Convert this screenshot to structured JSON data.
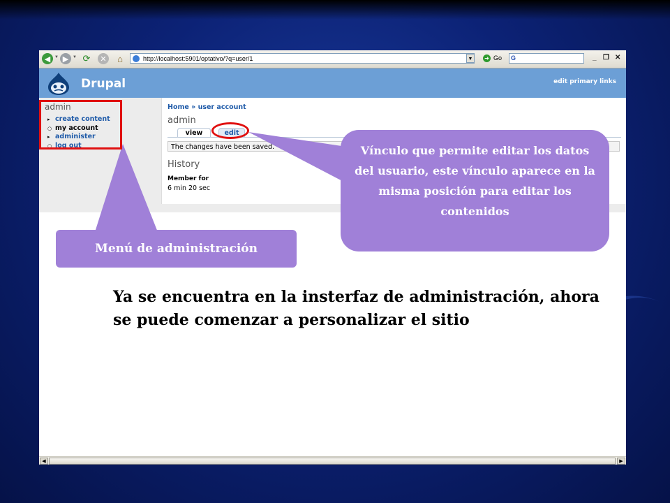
{
  "browser": {
    "address_url": "http://localhost:5901/optativo/?q=user/1",
    "go_label": "Go",
    "search_text": "G",
    "window_controls": [
      "_",
      "❐",
      "✕"
    ]
  },
  "drupal": {
    "site_name": "Drupal",
    "primary_links_label": "edit primary links",
    "sidebar": {
      "title": "admin",
      "items": [
        {
          "label": "create content",
          "bullet": "▸"
        },
        {
          "label": "my account",
          "bullet": "○"
        },
        {
          "label": "administer",
          "bullet": "▸"
        },
        {
          "label": "log out",
          "bullet": "○"
        }
      ]
    },
    "breadcrumb": "Home » user account",
    "page_title": "admin",
    "tabs": {
      "view": "view",
      "edit": "edit"
    },
    "status_message": "The changes have been saved.",
    "history_title": "History",
    "member_for_label": "Member for",
    "member_for_value": "6 min 20 sec"
  },
  "annotations": {
    "menu_callout": "Menú de administración",
    "edit_callout": "Vínculo que permite editar los datos del usuario, este vínculo aparece en la misma posición para editar los contenidos",
    "callout_color": "#a080d8",
    "highlight_color": "#e01010"
  },
  "slide_text": "Ya se encuentra en la insterfaz de administración, ahora se puede comenzar a personalizar el sitio"
}
